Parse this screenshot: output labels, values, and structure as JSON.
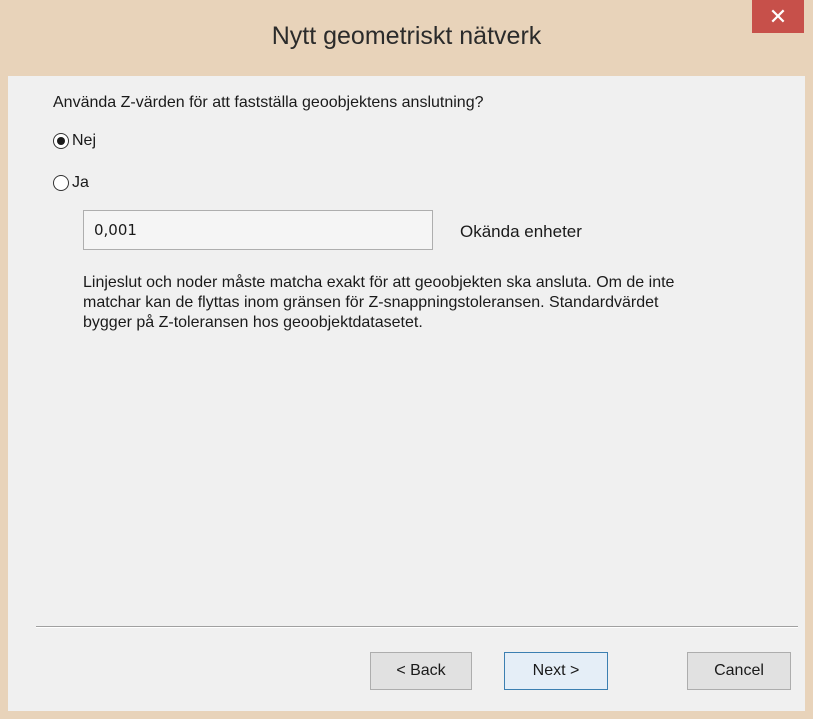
{
  "window": {
    "title": "Nytt geometriskt nätverk",
    "close_symbol": "✕"
  },
  "question": "Använda Z-värden för att fastställa geoobjektens anslutning?",
  "options": [
    {
      "label": "Nej",
      "checked": true
    },
    {
      "label": "Ja",
      "checked": false
    }
  ],
  "tolerance": {
    "value": "0,001",
    "unit": "Okända enheter"
  },
  "description": "Linjeslut och noder måste matcha exakt för att geoobjekten ska ansluta. Om de inte matchar kan de flyttas inom gränsen för Z-snappningstoleransen. Standardvärdet bygger på Z-toleransen hos geoobjektdatasetet.",
  "buttons": {
    "back": "< Back",
    "next": "Next >",
    "cancel": "Cancel"
  }
}
